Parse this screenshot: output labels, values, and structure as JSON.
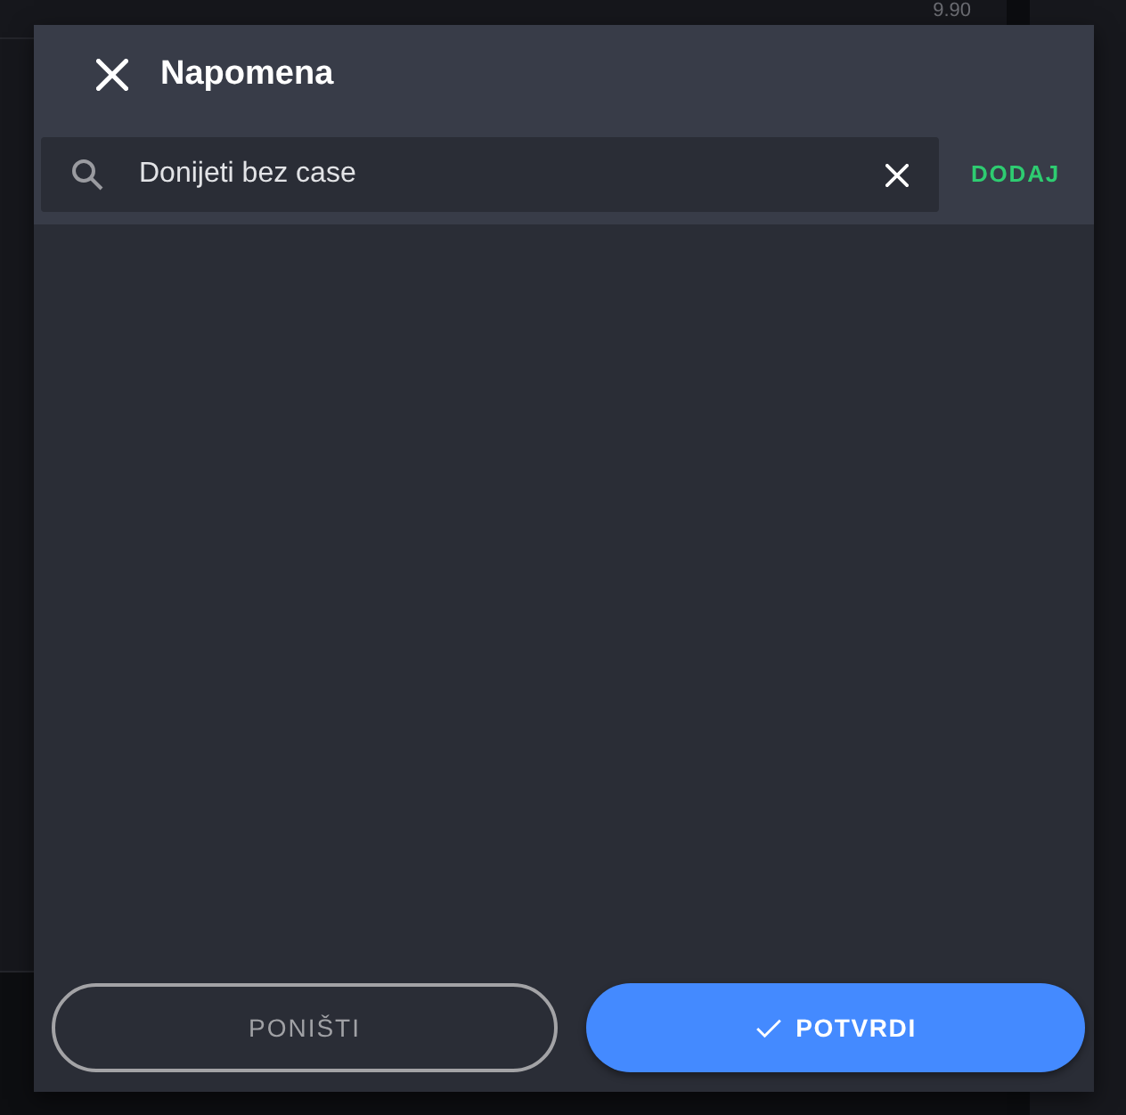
{
  "background": {
    "price": "9.90"
  },
  "dialog": {
    "title": "Napomena",
    "search": {
      "value": "Donijeti bez case"
    },
    "add_button": "DODAJ"
  },
  "buttons": [
    {
      "label": "PONIŠTI",
      "kind": "cancel"
    },
    {
      "label": "POTVRDI",
      "kind": "confirm"
    }
  ]
}
